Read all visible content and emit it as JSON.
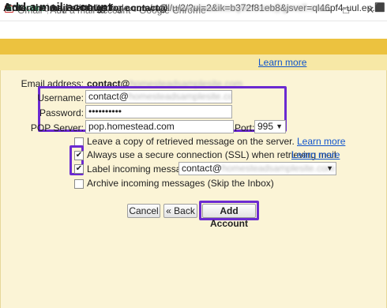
{
  "window": {
    "title": "Gmail - Add a mail account - Google Chrome",
    "minimize_icon": "minimize-icon",
    "maximize_icon": "maximize-icon",
    "close_icon": "close-icon"
  },
  "address_bar": {
    "secure_label": "Secure",
    "url": "https://mail.google.com/mail/u/2/?ui=2&ik=b372f81eb8&jsver=ql46pf4-uul.en.&cbl...",
    "extension_icon": "extension-icon"
  },
  "page": {
    "title": "Add a mail account",
    "settings_prefix": "Enter the mail settings for contact@",
    "settings_email_blurred": "homesteadsample.com@gmail.com",
    "learn_more": "Learn more"
  },
  "form": {
    "email_label": "Email address:",
    "email_value": "contact@",
    "email_blurred": "homesteadsamplesite.com",
    "username_label": "Username:",
    "username_value": "contact@",
    "username_blurred": "homesteadsamplesite.com",
    "password_label": "Password:",
    "password_value": "••••••••••",
    "pop_label": "POP Server:",
    "pop_value": "pop.homestead.com",
    "port_label": "Port:",
    "port_value": "995"
  },
  "options": {
    "leave_copy": {
      "label": "Leave a copy of retrieved message on the server.",
      "link": "Learn more",
      "checked": false
    },
    "ssl": {
      "label": "Always use a secure connection (SSL) when retrieving mail.",
      "link": "Learn more",
      "checked": true
    },
    "label_incoming": {
      "label": "Label incoming messages:",
      "value": "contact@",
      "blurred": "homesteadsamplesite.com",
      "checked": true
    },
    "archive": {
      "label": "Archive incoming messages (Skip the Inbox)",
      "checked": false
    }
  },
  "buttons": {
    "cancel": "Cancel",
    "back": "« Back",
    "add_account": "Add Account"
  },
  "colors": {
    "header": "#ecc23f",
    "panel": "#fbf4d6",
    "highlight": "#6b2ad1",
    "link": "#1155cc",
    "secure": "#0b8043"
  }
}
